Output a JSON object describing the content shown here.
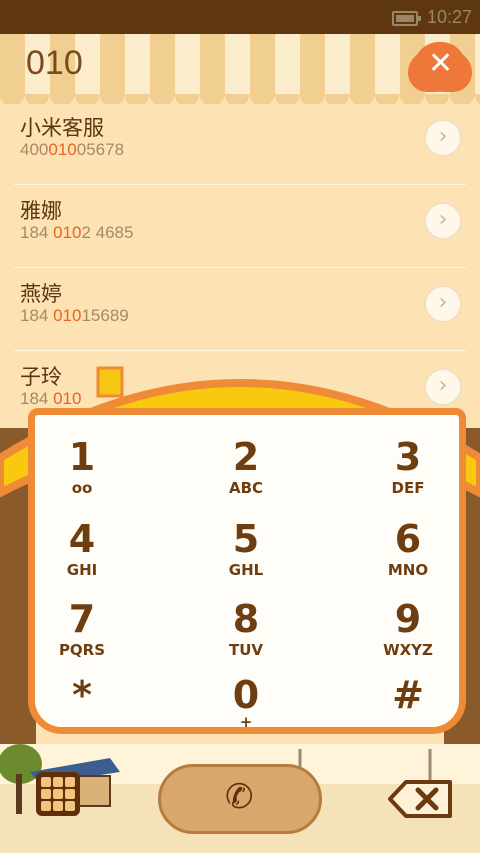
{
  "status_bar": {
    "time": "10:27"
  },
  "search": {
    "query": "010"
  },
  "contacts": [
    {
      "name": "小米客服",
      "number_pre": "400",
      "number_hit": "010",
      "number_post": "05678"
    },
    {
      "name": "雅娜",
      "number_pre": "184 ",
      "number_hit": "010",
      "number_post": "2 4685"
    },
    {
      "name": "燕婷",
      "number_pre": "184 ",
      "number_hit": "010",
      "number_post": "15689"
    },
    {
      "name": "子玲",
      "number_pre": "184 ",
      "number_hit": "010",
      "number_post": ""
    }
  ],
  "dialpad": {
    "keys": [
      {
        "digit": "1",
        "letters": "oo"
      },
      {
        "digit": "2",
        "letters": "ABC"
      },
      {
        "digit": "3",
        "letters": "DEF"
      },
      {
        "digit": "4",
        "letters": "GHI"
      },
      {
        "digit": "5",
        "letters": "GHL"
      },
      {
        "digit": "6",
        "letters": "MNO"
      },
      {
        "digit": "7",
        "letters": "PQRS"
      },
      {
        "digit": "8",
        "letters": "TUV"
      },
      {
        "digit": "9",
        "letters": "WXYZ"
      },
      {
        "digit": "*",
        "letters": ""
      },
      {
        "digit": "0",
        "letters": "+"
      },
      {
        "digit": "#",
        "letters": ""
      }
    ]
  },
  "colors": {
    "accent": "#ef8a36",
    "highlight": "#e9641f",
    "roof": "#f9c910"
  }
}
